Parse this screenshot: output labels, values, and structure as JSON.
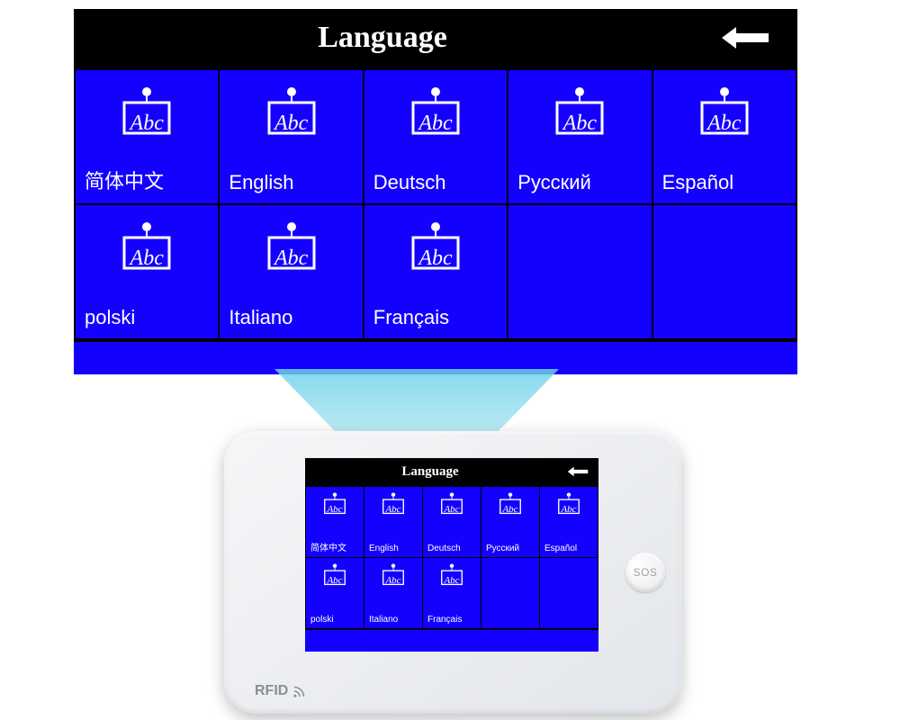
{
  "screen": {
    "title": "Language",
    "icon_text": "Abc",
    "languages": [
      "简体中文",
      "English",
      "Deutsch",
      "Русский",
      "Español",
      "polski",
      "Italiano",
      "Français"
    ]
  },
  "device": {
    "sos_label": "SOS",
    "rfid_label": "RFID"
  }
}
